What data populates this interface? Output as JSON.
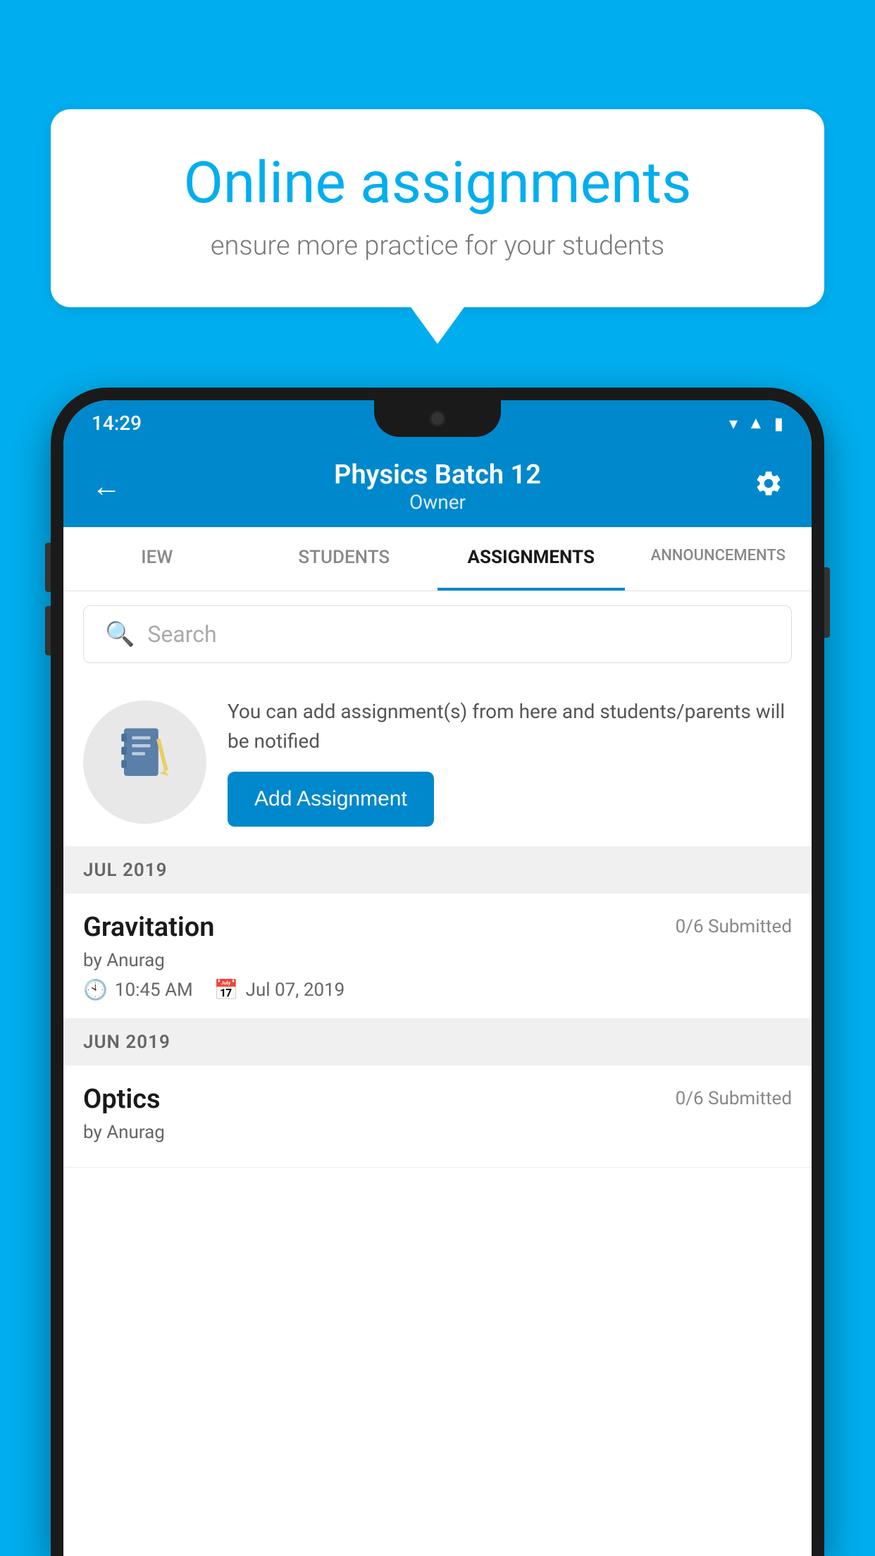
{
  "background_color": "#00AEEF",
  "speech_bubble": {
    "title": "Online assignments",
    "subtitle": "ensure more practice for your students"
  },
  "phone": {
    "status_bar": {
      "time": "14:29",
      "icons": [
        "wifi",
        "signal",
        "battery"
      ]
    },
    "top_bar": {
      "title": "Physics Batch 12",
      "subtitle": "Owner",
      "back_label": "←",
      "settings_label": "⚙"
    },
    "tabs": [
      {
        "label": "IEW",
        "active": false
      },
      {
        "label": "STUDENTS",
        "active": false
      },
      {
        "label": "ASSIGNMENTS",
        "active": true
      },
      {
        "label": "ANNOUNCEMENTS",
        "active": false
      }
    ],
    "search": {
      "placeholder": "Search"
    },
    "promo": {
      "text": "You can add assignment(s) from here and students/parents will be notified",
      "button_label": "Add Assignment"
    },
    "sections": [
      {
        "header": "JUL 2019",
        "assignments": [
          {
            "title": "Gravitation",
            "submitted": "0/6 Submitted",
            "author": "by Anurag",
            "time": "10:45 AM",
            "date": "Jul 07, 2019"
          }
        ]
      },
      {
        "header": "JUN 2019",
        "assignments": [
          {
            "title": "Optics",
            "submitted": "0/6 Submitted",
            "author": "by Anurag",
            "time": "",
            "date": ""
          }
        ]
      }
    ]
  }
}
